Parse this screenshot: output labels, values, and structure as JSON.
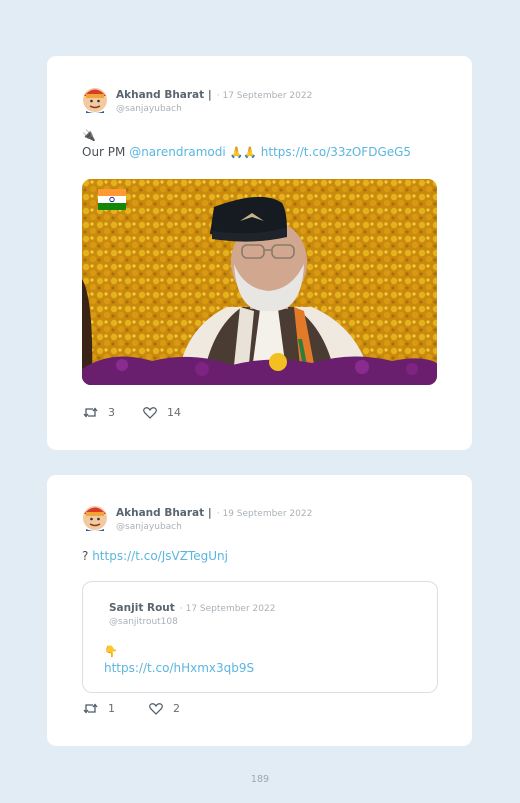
{
  "tweets": [
    {
      "author": "Akhand Bharat |",
      "date": "· 17 September 2022",
      "handle": "@sanjayubach",
      "emoji_line": "🔌",
      "text_prefix": "Our PM ",
      "mention": "@narendramodi",
      "emojis": "🙏🙏",
      "url": "https://t.co/33zOFDGeG5",
      "retweets": "3",
      "likes": "14"
    },
    {
      "author": "Akhand Bharat |",
      "date": "· 19 September 2022",
      "handle": "@sanjayubach",
      "text_prefix": "? ",
      "url": "https://t.co/JsVZTegUnj",
      "quoted": {
        "author": "Sanjit Rout",
        "date": "· 17 September 2022",
        "handle": "@sanjitrout108",
        "emoji": "👇",
        "url": "https://t.co/hHxmx3qb9S"
      },
      "retweets": "1",
      "likes": "2"
    }
  ],
  "page_number": "189",
  "colors": {
    "background": "#e1ecf4",
    "link": "#5bb5e0",
    "card": "#ffffff"
  }
}
